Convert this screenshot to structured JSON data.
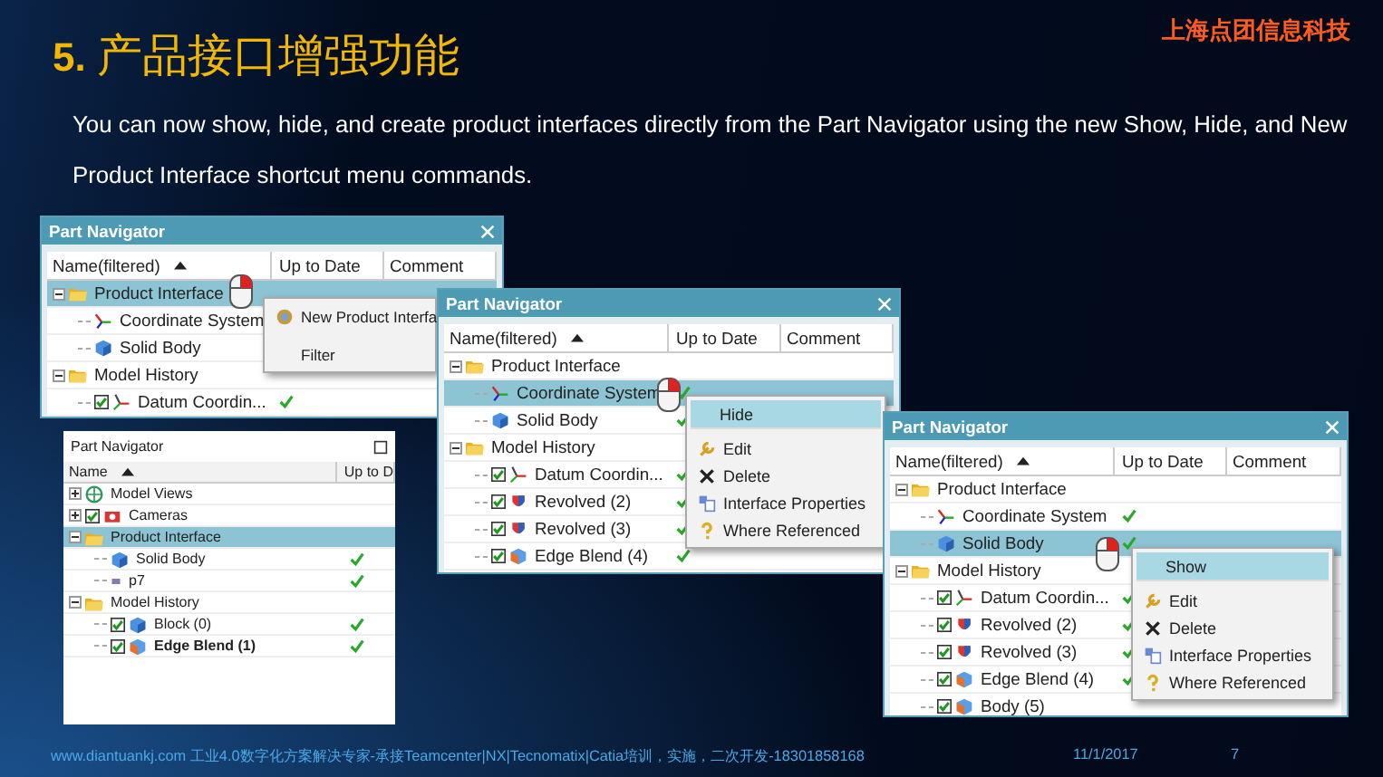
{
  "slide": {
    "number": "5.",
    "title": "产品接口增强功能",
    "company": "上海点团信息科技",
    "body": "You can now show, hide, and create product interfaces directly from the Part Navigator using the new Show, Hide, and New Product Interface shortcut menu commands."
  },
  "navigators": [
    {
      "title": "Part Navigator",
      "columns": [
        "Name(filtered)",
        "Up to Date",
        "Comment"
      ],
      "rows": [
        {
          "label": "Product Interface",
          "kind": "folder",
          "expanded": true,
          "selected": true,
          "up_to_date": false,
          "children": [
            {
              "label": "Coordinate System",
              "kind": "csys",
              "selected": false,
              "up_to_date": false
            },
            {
              "label": "Solid Body",
              "kind": "body",
              "selected": false,
              "up_to_date": false
            }
          ]
        },
        {
          "label": "Model History",
          "kind": "folder",
          "expanded": true,
          "selected": false,
          "up_to_date": false,
          "children": [
            {
              "label": "Datum Coordin...",
              "kind": "datum",
              "checked": true,
              "selected": false,
              "up_to_date": true
            }
          ]
        }
      ],
      "menu": {
        "items": [
          {
            "label": "New Product Interfa",
            "kind": "new",
            "selected": false
          },
          {
            "label": "Filter",
            "kind": "plain",
            "selected": false
          }
        ]
      }
    },
    {
      "title": "Part Navigator",
      "columns": [
        "Name(filtered)",
        "Up to Date",
        "Comment"
      ],
      "rows": [
        {
          "label": "Product Interface",
          "kind": "folder",
          "expanded": true,
          "selected": false,
          "up_to_date": false,
          "children": [
            {
              "label": "Coordinate System",
              "kind": "csys",
              "selected": true,
              "up_to_date": true
            },
            {
              "label": "Solid Body",
              "kind": "body",
              "selected": false,
              "up_to_date": true
            }
          ]
        },
        {
          "label": "Model History",
          "kind": "folder",
          "expanded": true,
          "selected": false,
          "up_to_date": false,
          "children": [
            {
              "label": "Datum Coordin...",
              "kind": "datum",
              "checked": true,
              "selected": false,
              "up_to_date": true
            },
            {
              "label": "Revolved (2)",
              "kind": "revolve",
              "checked": true,
              "selected": false,
              "up_to_date": true
            },
            {
              "label": "Revolved (3)",
              "kind": "revolve",
              "checked": true,
              "selected": false,
              "up_to_date": true
            },
            {
              "label": "Edge Blend (4)",
              "kind": "blend",
              "checked": true,
              "selected": false,
              "up_to_date": true
            }
          ]
        }
      ],
      "menu": {
        "items": [
          {
            "label": "Hide",
            "kind": "header",
            "selected": true
          },
          {
            "label": "Edit",
            "kind": "edit",
            "selected": false
          },
          {
            "label": "Delete",
            "kind": "delete",
            "selected": false
          },
          {
            "label": "Interface Properties",
            "kind": "properties",
            "selected": false
          },
          {
            "label": "Where Referenced",
            "kind": "where",
            "selected": false
          }
        ]
      }
    },
    {
      "title": "Part Navigator",
      "columns": [
        "Name(filtered)",
        "Up to Date",
        "Comment"
      ],
      "rows": [
        {
          "label": "Product Interface",
          "kind": "folder",
          "expanded": true,
          "selected": false,
          "up_to_date": false,
          "children": [
            {
              "label": "Coordinate System",
              "kind": "csys",
              "selected": false,
              "up_to_date": true
            },
            {
              "label": "Solid Body",
              "kind": "body",
              "selected": true,
              "up_to_date": true
            }
          ]
        },
        {
          "label": "Model History",
          "kind": "folder",
          "expanded": true,
          "selected": false,
          "up_to_date": false,
          "children": [
            {
              "label": "Datum Coordin...",
              "kind": "datum",
              "checked": true,
              "selected": false,
              "up_to_date": true
            },
            {
              "label": "Revolved (2)",
              "kind": "revolve",
              "checked": true,
              "selected": false,
              "up_to_date": true
            },
            {
              "label": "Revolved (3)",
              "kind": "revolve",
              "checked": true,
              "selected": false,
              "up_to_date": true
            },
            {
              "label": "Edge Blend (4)",
              "kind": "blend",
              "checked": true,
              "selected": false,
              "up_to_date": true
            },
            {
              "label": "Body (5)",
              "kind": "blend",
              "checked": true,
              "selected": false,
              "up_to_date": false
            }
          ]
        }
      ],
      "menu": {
        "items": [
          {
            "label": "Show",
            "kind": "header",
            "selected": true
          },
          {
            "label": "Edit",
            "kind": "edit",
            "selected": false
          },
          {
            "label": "Delete",
            "kind": "delete",
            "selected": false
          },
          {
            "label": "Interface Properties",
            "kind": "properties",
            "selected": false
          },
          {
            "label": "Where Referenced",
            "kind": "where",
            "selected": false
          }
        ]
      }
    },
    {
      "title": "Part Navigator",
      "columns": [
        "Name",
        "Up to D"
      ],
      "rows": [
        {
          "label": "Model Views",
          "kind": "views",
          "expanded": false,
          "selected": false,
          "up_to_date": false
        },
        {
          "label": "Cameras",
          "kind": "cameras",
          "expanded": false,
          "checked": true,
          "selected": false,
          "up_to_date": false
        },
        {
          "label": "Product Interface",
          "kind": "folder",
          "expanded": true,
          "selected": true,
          "up_to_date": false,
          "children": [
            {
              "label": "Solid Body",
              "kind": "body",
              "selected": false,
              "up_to_date": true
            },
            {
              "label": "p7",
              "kind": "point",
              "selected": false,
              "up_to_date": true
            }
          ]
        },
        {
          "label": "Model History",
          "kind": "folder",
          "expanded": true,
          "selected": false,
          "up_to_date": false,
          "children": [
            {
              "label": "Block (0)",
              "kind": "body",
              "checked": true,
              "current": false,
              "selected": false,
              "up_to_date": true
            },
            {
              "label": "Edge Blend (1)",
              "kind": "blend",
              "checked": true,
              "current": true,
              "selected": false,
              "up_to_date": true
            }
          ]
        }
      ]
    }
  ],
  "footer": {
    "text": "www.diantuankj.com 工业4.0数字化方案解决专家-承接Teamcenter|NX|Tecnomatix|Catia培训，实施，二次开发-18301858168",
    "date": "11/1/2017",
    "page": "7"
  }
}
